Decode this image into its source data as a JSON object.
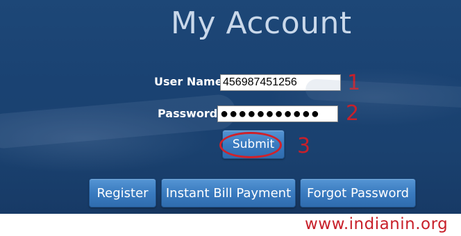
{
  "page": {
    "title": "My Account"
  },
  "form": {
    "username_label": "User Name",
    "username_value": "456987451256",
    "password_label": "Password",
    "password_value": "●●●●●●●●●●●",
    "submit_label": "Submit"
  },
  "annotations": {
    "step1": "1",
    "step2": "2",
    "step3": "3"
  },
  "actions": {
    "register_label": "Register",
    "instant_bill_label": "Instant Bill Payment",
    "forgot_password_label": "Forgot Password"
  },
  "watermark": {
    "website": "www.indianin.org"
  },
  "colors": {
    "background": "#1a4272",
    "button": "#3a7bc0",
    "annotation_red": "#c8202a"
  }
}
